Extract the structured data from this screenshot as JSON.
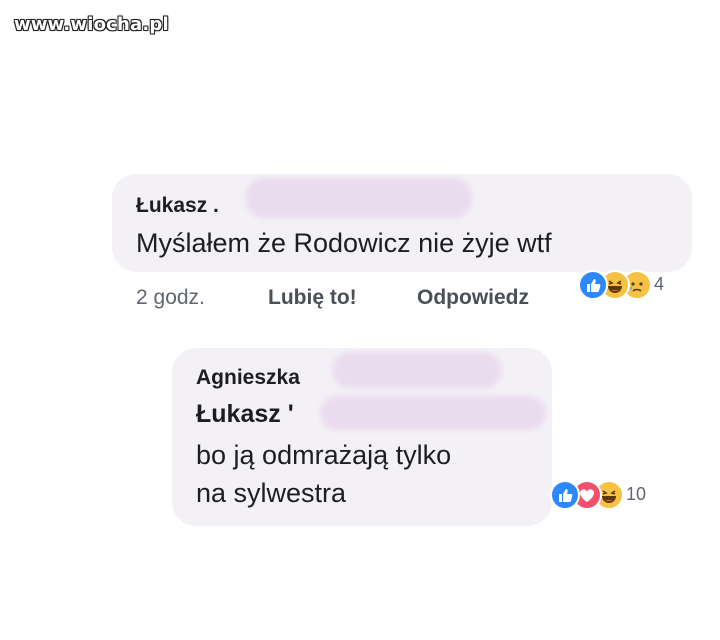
{
  "watermark": "www.wiocha.pl",
  "comment1": {
    "author": "Łukasz .",
    "text": "Myślałem że Rodowicz nie żyje wtf",
    "time": "2 godz.",
    "like_label": "Lubię to!",
    "reply_label": "Odpowiedz",
    "reaction_icons": [
      "like-icon",
      "haha-icon",
      "sad-icon"
    ],
    "reaction_count": "4"
  },
  "reply1": {
    "author": "Agnieszka",
    "mention": "Łukasz '",
    "line1": "bo ją odmrażają tylko",
    "line2": "na sylwestra",
    "reaction_icons": [
      "like-icon",
      "love-icon",
      "haha-icon"
    ],
    "reaction_count": "10"
  },
  "colors": {
    "bubble": "#f3f1f6",
    "redaction": "#ead9ee",
    "like": "#2d88ff",
    "love": "#f0506e",
    "haha": "#f7c244"
  }
}
